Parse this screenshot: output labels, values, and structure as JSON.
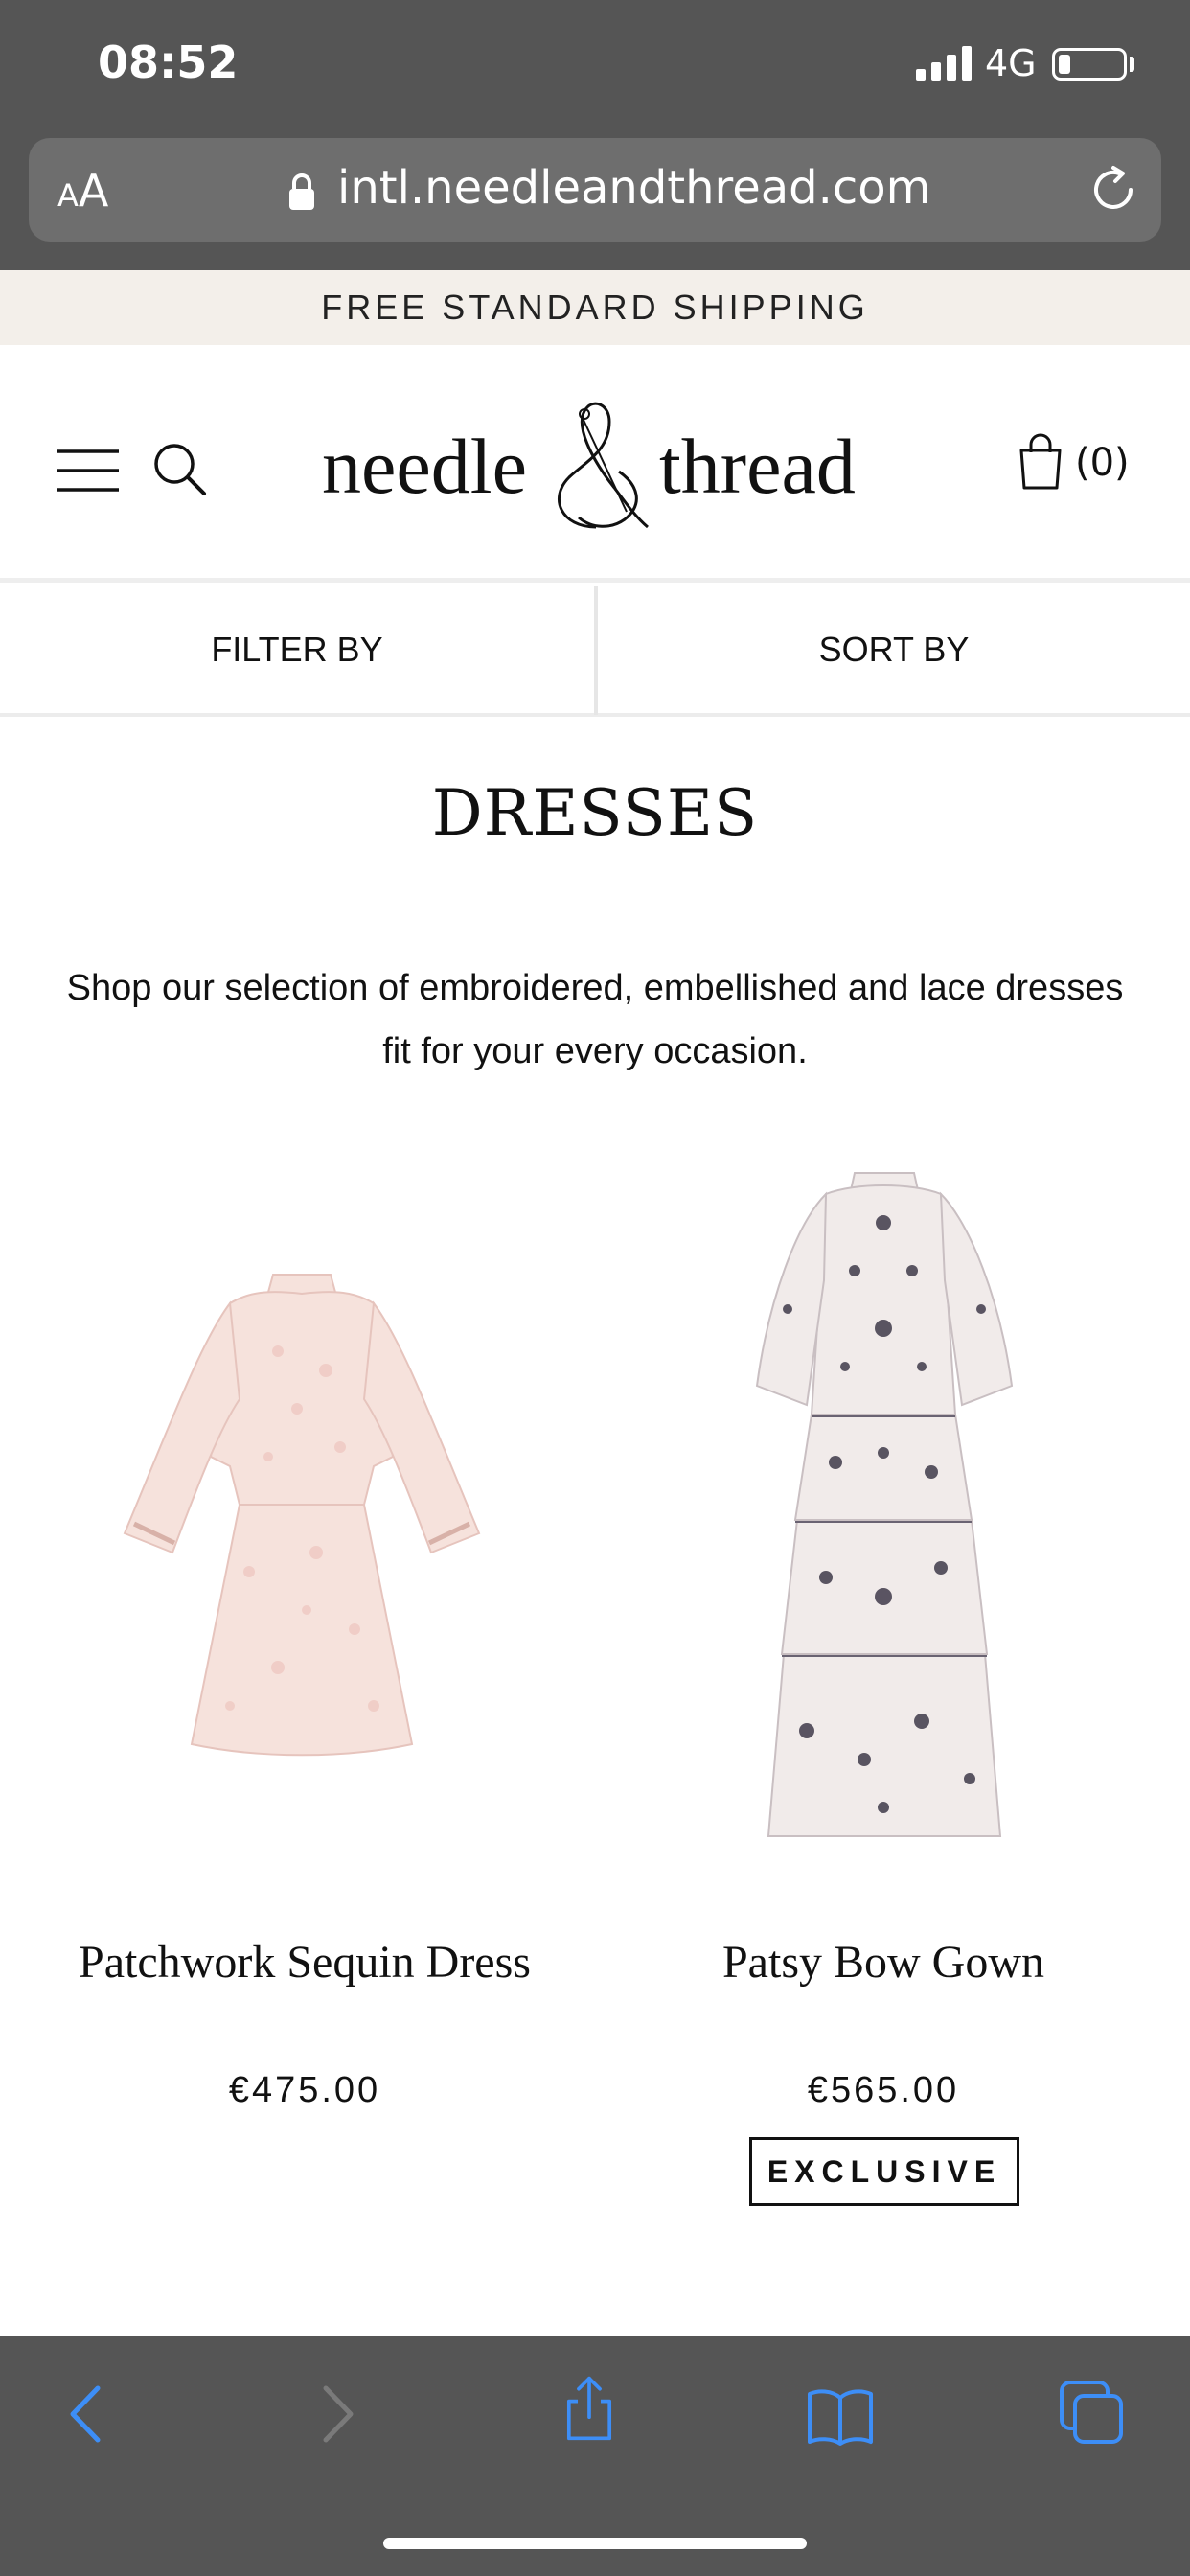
{
  "status_bar": {
    "time": "08:52",
    "network": "4G",
    "signal_icon": "signal-bars-icon",
    "battery_icon": "battery-low-icon"
  },
  "browser": {
    "text_size_small": "A",
    "text_size_large": "A",
    "url": "intl.needleandthread.com",
    "lock_icon": "lock-icon",
    "reload_icon": "reload-icon"
  },
  "banner": {
    "text": "FREE STANDARD SHIPPING"
  },
  "header": {
    "menu_icon": "hamburger-menu-icon",
    "search_icon": "search-icon",
    "logo": {
      "word1": "needle",
      "word2": "thread"
    },
    "cart_icon": "shopping-bag-icon",
    "cart_count": "(0)"
  },
  "toolbar": {
    "filter_label": "FILTER BY",
    "sort_label": "SORT BY"
  },
  "category": {
    "title": "DRESSES",
    "description": "Shop our selection of embroidered, embellished and lace dresses fit for your every occasion."
  },
  "products": [
    {
      "name": "Patchwork Sequin Dress",
      "price": "€475.00",
      "color": "#f3d9d4"
    },
    {
      "name": "Patsy Bow Gown",
      "price": "€565.00",
      "badge": "EXCLUSIVE",
      "color": "#efe6e6"
    }
  ],
  "bottom_nav": {
    "back_icon": "chevron-left-icon",
    "forward_icon": "chevron-right-icon",
    "share_icon": "share-icon",
    "bookmarks_icon": "book-icon",
    "tabs_icon": "tabs-icon",
    "active_color": "#3d8ef7",
    "disabled_color": "#7a7a7a"
  }
}
